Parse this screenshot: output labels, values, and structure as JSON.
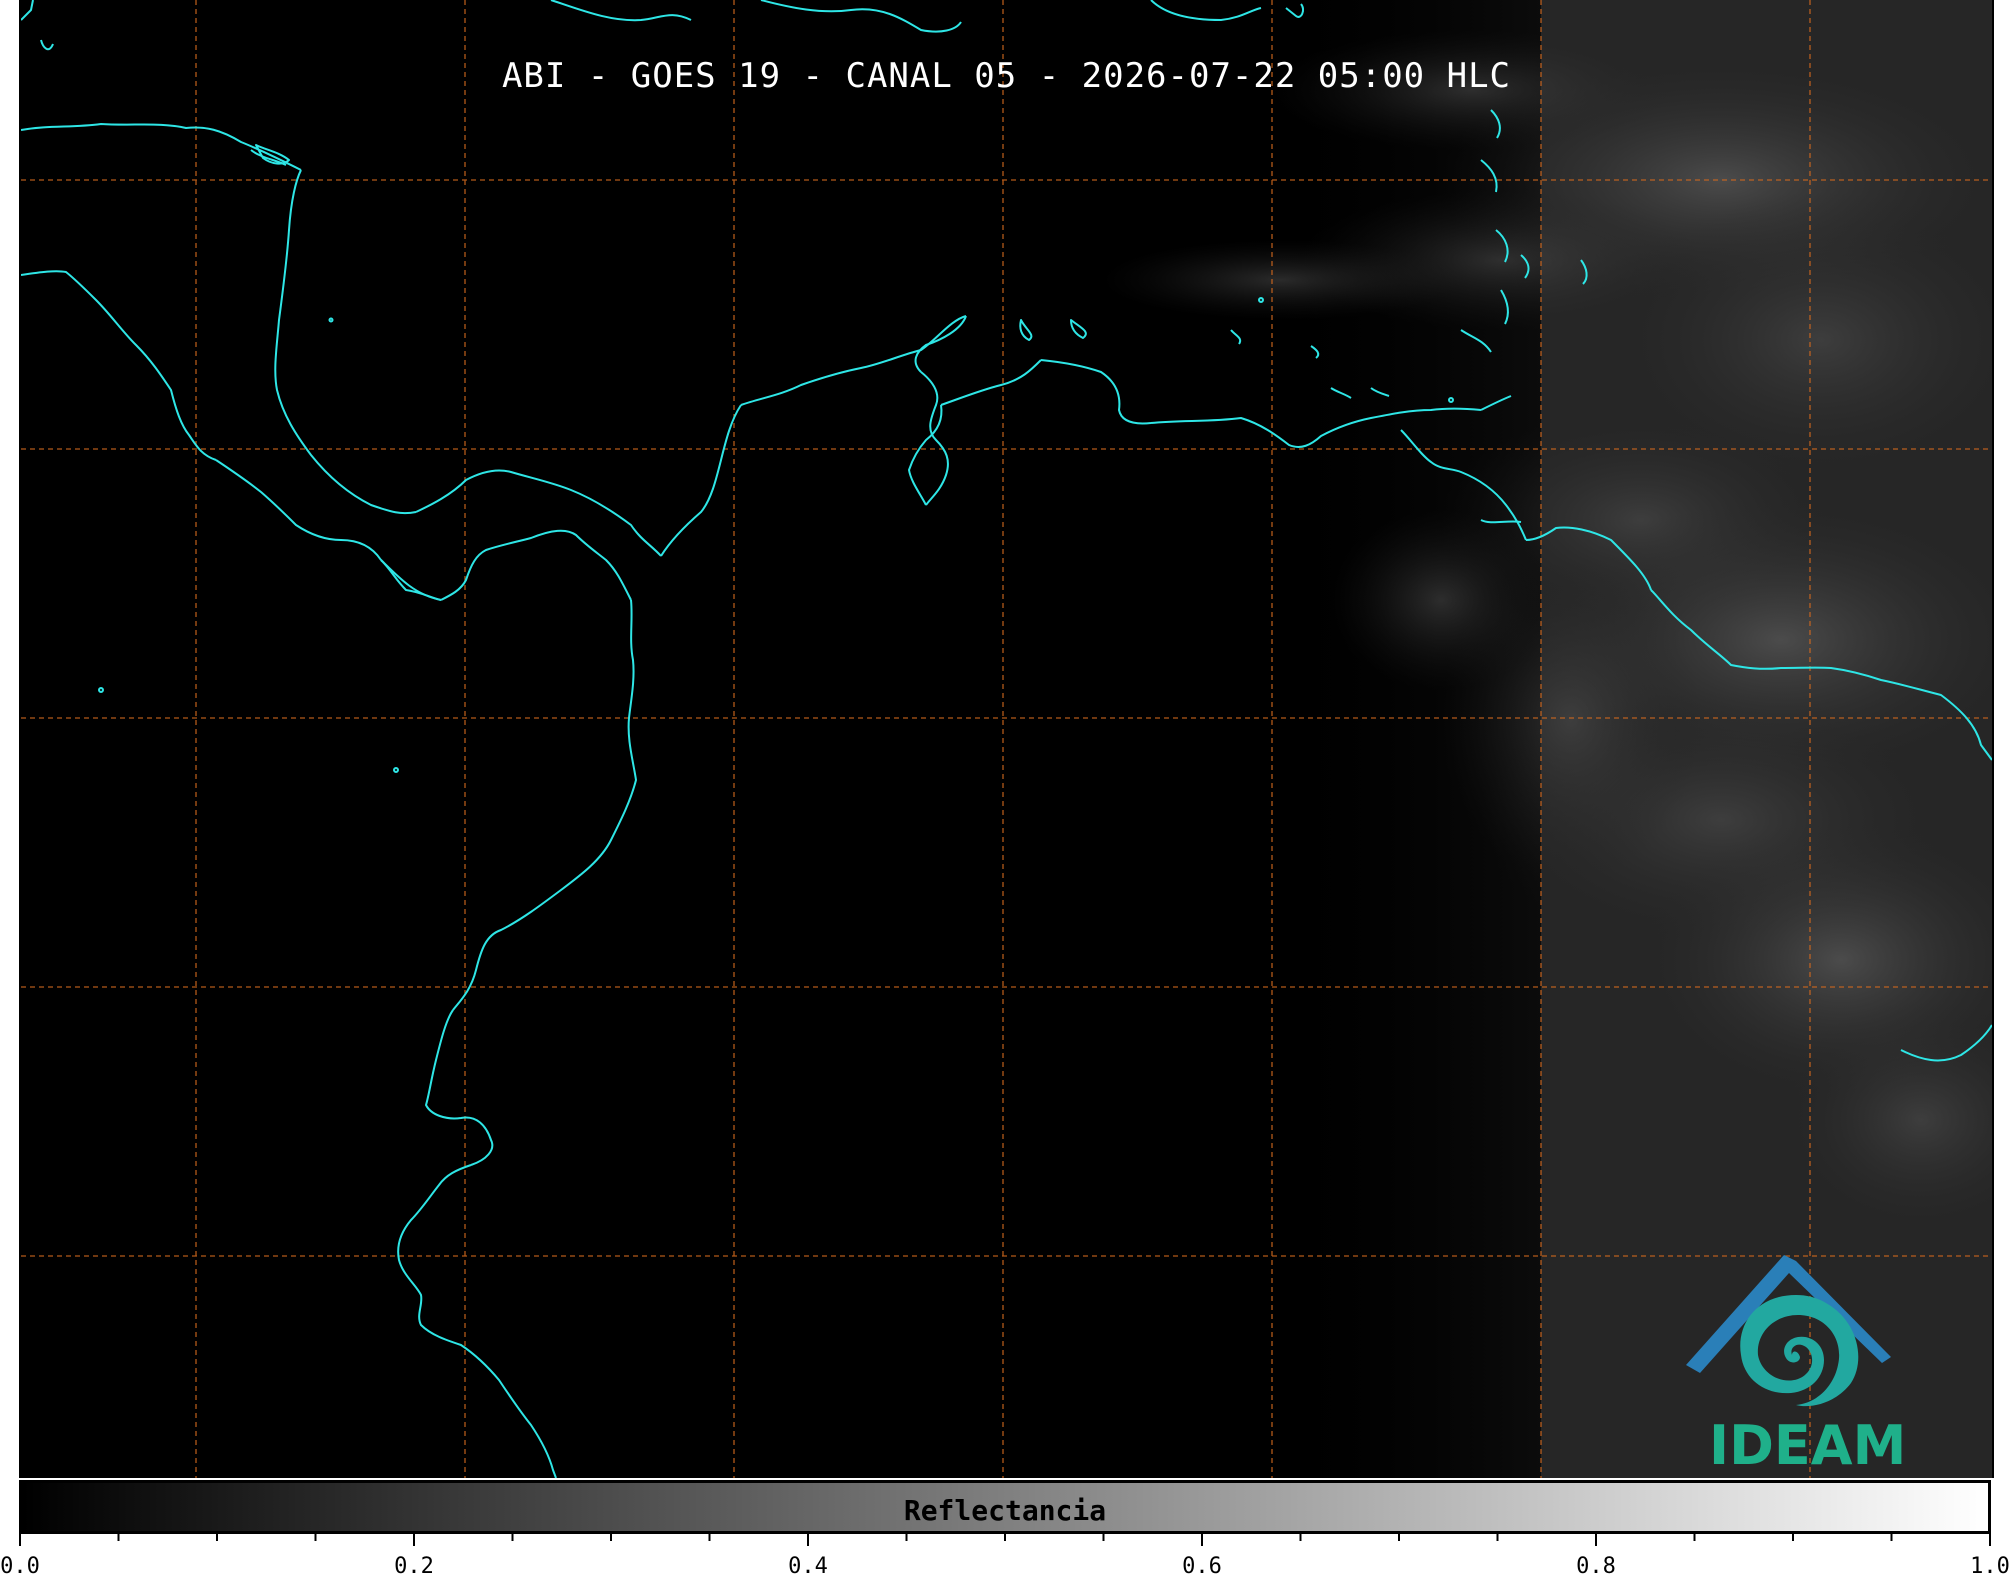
{
  "title": "ABI - GOES 19 - CANAL 05 - 2026-07-22 05:00 HLC",
  "colorbar": {
    "label": "Reflectancia",
    "range": [
      0.0,
      1.0
    ],
    "tick_labels": [
      "0.0",
      "0.2",
      "0.4",
      "0.6",
      "0.8",
      "1.0"
    ],
    "colormap": [
      "#000000",
      "#ffffff"
    ]
  },
  "logo": {
    "text": "IDEAM",
    "colors": {
      "text": "#1fb08a",
      "roof": "#2a7fb8",
      "swirl": "#22a8a0"
    }
  },
  "map": {
    "coastline_color": "#2ee6e6",
    "gridline_color": "#d2691e",
    "gridline_style": "dashed"
  }
}
